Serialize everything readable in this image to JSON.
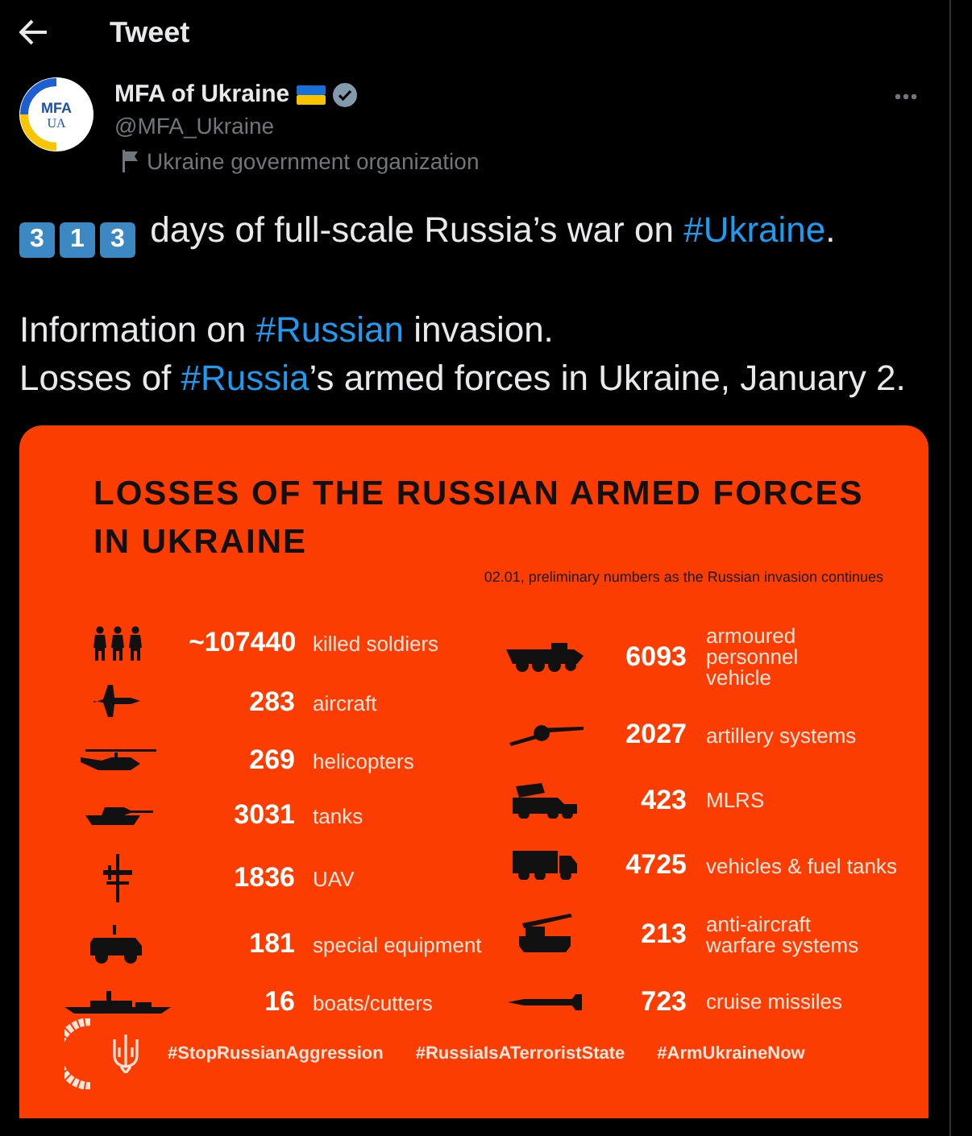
{
  "header": {
    "title": "Tweet"
  },
  "author": {
    "name": "MFA of Ukraine",
    "handle": "@MFA_Ukraine",
    "label": "Ukraine government organization",
    "avatar_text": [
      "MFA",
      "UA"
    ]
  },
  "tweet": {
    "paragraphs": [
      [
        [
          {
            "kind": "keycap",
            "text": "3"
          },
          {
            "kind": "keycap",
            "text": "1"
          },
          {
            "kind": "keycap",
            "text": "3"
          },
          {
            "kind": "text",
            "text": " days of full-scale Russia’s war on "
          },
          {
            "kind": "hashtag",
            "text": "#Ukraine"
          },
          {
            "kind": "text",
            "text": "."
          }
        ]
      ],
      [
        [
          {
            "kind": "text",
            "text": "Information on "
          },
          {
            "kind": "hashtag",
            "text": "#Russian"
          },
          {
            "kind": "text",
            "text": " invasion."
          }
        ],
        [
          {
            "kind": "text",
            "text": "Losses of "
          },
          {
            "kind": "hashtag",
            "text": "#Russia"
          },
          {
            "kind": "text",
            "text": "’s armed forces in Ukraine, January 2."
          }
        ]
      ]
    ]
  },
  "infographic": {
    "title": "LOSSES OF THE RUSSIAN ARMED FORCES IN UKRAINE",
    "subtitle": "02.01, preliminary numbers as the Russian invasion continues",
    "left": [
      {
        "kind": "soldiers",
        "value": "~107440",
        "label": "killed soldiers"
      },
      {
        "kind": "jet",
        "value": "283",
        "label": "aircraft"
      },
      {
        "kind": "helicopter",
        "value": "269",
        "label": "helicopters"
      },
      {
        "kind": "tank",
        "value": "3031",
        "label": "tanks"
      },
      {
        "kind": "drone",
        "value": "1836",
        "label": "UAV"
      },
      {
        "kind": "armored-car",
        "value": "181",
        "label": "special equipment"
      },
      {
        "kind": "ship",
        "value": "16",
        "label": "boats/cutters"
      }
    ],
    "right": [
      {
        "kind": "apc",
        "value": "6093",
        "label": "armoured\npersonnel\nvehicle"
      },
      {
        "kind": "artillery",
        "value": "2027",
        "label": "artillery systems"
      },
      {
        "kind": "mlrs",
        "value": "423",
        "label": "MLRS"
      },
      {
        "kind": "truck",
        "value": "4725",
        "label": "vehicles & fuel tanks"
      },
      {
        "kind": "anti-aircraft",
        "value": "213",
        "label": "anti-aircraft\nwarfare systems"
      },
      {
        "kind": "missile",
        "value": "723",
        "label": "cruise missiles"
      }
    ],
    "hashtags": [
      "#StopRussianAggression",
      "#RussiaIsATerroristState",
      "#ArmUkraineNow"
    ]
  }
}
